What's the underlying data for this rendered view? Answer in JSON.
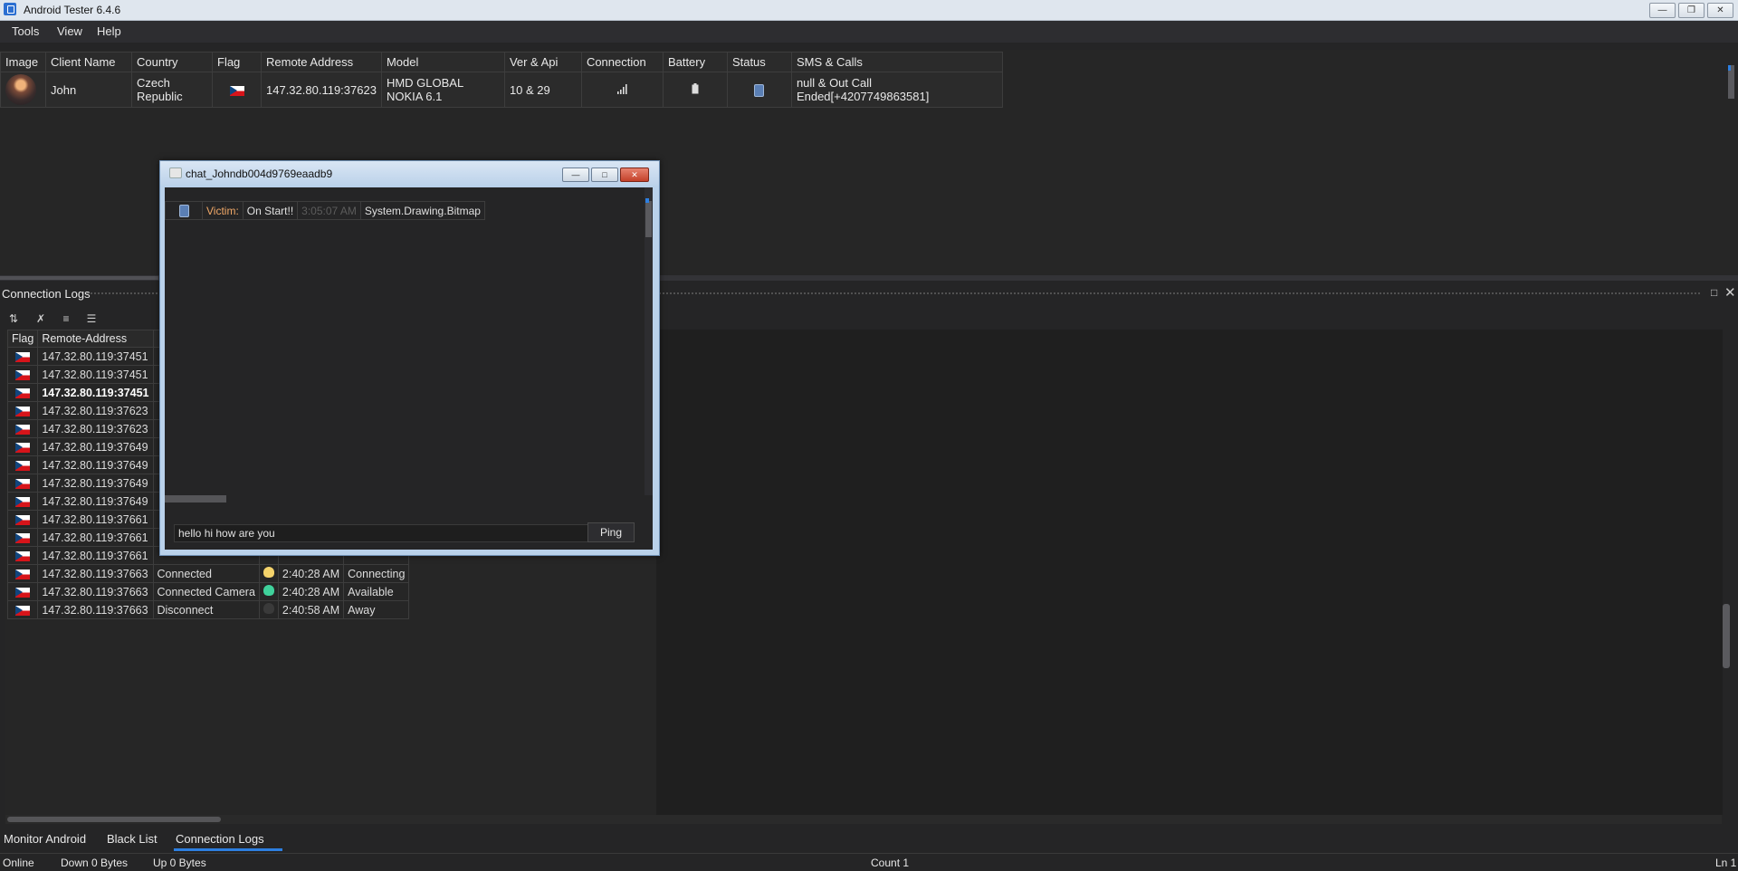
{
  "window": {
    "title": "Android Tester 6.4.6"
  },
  "menu": [
    "Tools",
    "View",
    "Help"
  ],
  "clients": {
    "columns": [
      "Image",
      "Client Name",
      "Country",
      "Flag",
      "Remote Address",
      "Model",
      "Ver & Api",
      "Connection",
      "Battery",
      "Status",
      "SMS & Calls"
    ],
    "rows": [
      {
        "client_name": "John",
        "country": "Czech Republic",
        "remote_address": "147.32.80.119:37623",
        "model": "HMD GLOBAL NOKIA 6.1",
        "ver_api": "10 & 29",
        "sms_calls": "null & Out Call Ended[+4207749863581]"
      }
    ]
  },
  "logs": {
    "title": "Connection Logs",
    "columns": [
      "Flag",
      "Remote-Address"
    ],
    "rows": [
      {
        "addr": "147.32.80.119:37451",
        "bold": false
      },
      {
        "addr": "147.32.80.119:37451",
        "bold": false
      },
      {
        "addr": "147.32.80.119:37451",
        "bold": true
      },
      {
        "addr": "147.32.80.119:37623",
        "bold": false
      },
      {
        "addr": "147.32.80.119:37623",
        "bold": false
      },
      {
        "addr": "147.32.80.119:37649",
        "bold": false
      },
      {
        "addr": "147.32.80.119:37649",
        "bold": false
      },
      {
        "addr": "147.32.80.119:37649",
        "bold": false
      },
      {
        "addr": "147.32.80.119:37649",
        "bold": false
      },
      {
        "addr": "147.32.80.119:37661",
        "bold": false
      },
      {
        "addr": "147.32.80.119:37661",
        "bold": false
      },
      {
        "addr": "147.32.80.119:37661",
        "bold": false
      },
      {
        "addr": "147.32.80.119:37663",
        "status": "Connected",
        "status_kind": "connected",
        "icon": "yellow",
        "time": "2:40:28 AM",
        "presence": "Connecting"
      },
      {
        "addr": "147.32.80.119:37663",
        "status": "Connected Camera",
        "status_kind": "camera",
        "icon": "green",
        "time": "2:40:28 AM",
        "presence": "Available"
      },
      {
        "addr": "147.32.80.119:37663",
        "status": "Disconnect",
        "status_kind": "disconnect",
        "icon": "grey",
        "time": "2:40:58 AM",
        "presence": "Away"
      }
    ]
  },
  "chat": {
    "title": "chat_Johndb004d9769eaadb9",
    "message": {
      "sender": "Victim:",
      "text": "On Start!!",
      "time": "3:05:07 AM",
      "attachment": "System.Drawing.Bitmap"
    },
    "input_value": "hello hi how are you",
    "ping_label": "Ping"
  },
  "tabs": [
    "Monitor Android",
    "Black List",
    "Connection Logs"
  ],
  "status": {
    "online": "Online",
    "down": "Down 0 Bytes",
    "up": "Up 0 Bytes",
    "count": "Count 1",
    "line": "Ln 1"
  },
  "colors": {
    "connected": "#3fd19b",
    "disconnect": "#f06a6a",
    "accent": "#2d7fe0",
    "sender": "#f0a868"
  }
}
